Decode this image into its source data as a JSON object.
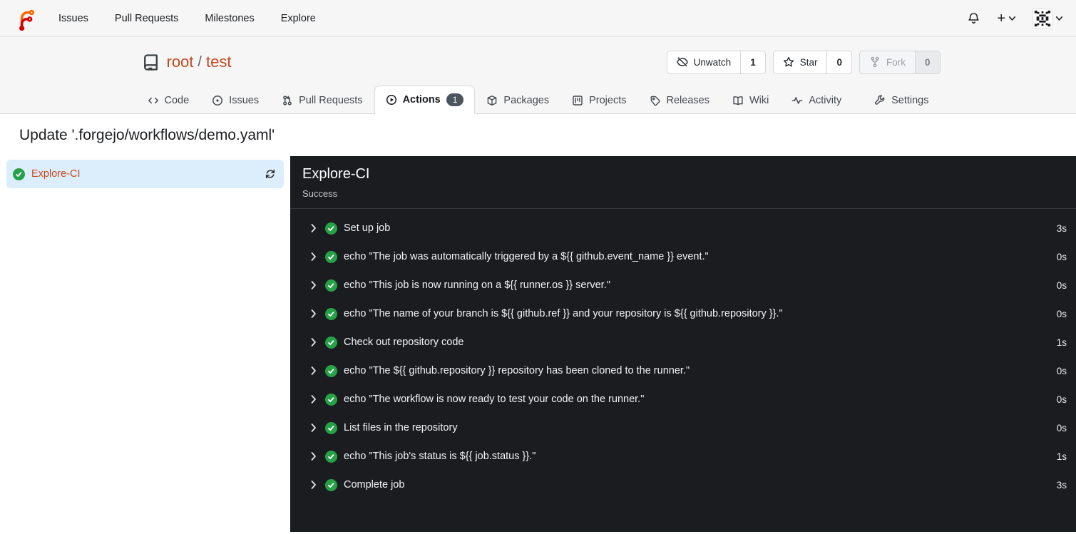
{
  "colors": {
    "accent_link": "#c7491f",
    "success_green": "#26a148",
    "selected_job_bg": "#dcedfb",
    "dark_panel_bg": "#1a1c1f",
    "tab_badge_bg": "#4c545f"
  },
  "navbar": {
    "links": [
      {
        "label": "Issues"
      },
      {
        "label": "Pull Requests"
      },
      {
        "label": "Milestones"
      },
      {
        "label": "Explore"
      }
    ]
  },
  "repo_header": {
    "owner": "root",
    "separator": "/",
    "name": "test",
    "buttons": [
      {
        "label": "Unwatch",
        "count": "1"
      },
      {
        "label": "Star",
        "count": "0"
      },
      {
        "label": "Fork",
        "count": "0"
      }
    ],
    "tabs": [
      {
        "label": "Code"
      },
      {
        "label": "Issues"
      },
      {
        "label": "Pull Requests"
      },
      {
        "label": "Actions",
        "badge": "1"
      },
      {
        "label": "Packages"
      },
      {
        "label": "Projects"
      },
      {
        "label": "Releases"
      },
      {
        "label": "Wiki"
      },
      {
        "label": "Activity"
      },
      {
        "label": "Settings"
      }
    ]
  },
  "page": {
    "title": "Update '.forgejo/workflows/demo.yaml'"
  },
  "sidebar": {
    "jobs": [
      {
        "label": "Explore-CI",
        "status": "success"
      }
    ]
  },
  "run_panel": {
    "job_title": "Explore-CI",
    "status": "Success",
    "steps": [
      {
        "label": "Set up job",
        "duration": "3s"
      },
      {
        "label": "echo \"The job was automatically triggered by a ${{ github.event_name }} event.\"",
        "duration": "0s"
      },
      {
        "label": "echo \"This job is now running on a ${{ runner.os }} server.\"",
        "duration": "0s"
      },
      {
        "label": "echo \"The name of your branch is ${{ github.ref }} and your repository is ${{ github.repository }}.\"",
        "duration": "0s"
      },
      {
        "label": "Check out repository code",
        "duration": "1s"
      },
      {
        "label": "echo \"The ${{ github.repository }} repository has been cloned to the runner.\"",
        "duration": "0s"
      },
      {
        "label": "echo \"The workflow is now ready to test your code on the runner.\"",
        "duration": "0s"
      },
      {
        "label": "List files in the repository",
        "duration": "0s"
      },
      {
        "label": "echo \"This job's status is ${{ job.status }}.\"",
        "duration": "1s"
      },
      {
        "label": "Complete job",
        "duration": "3s"
      }
    ]
  }
}
